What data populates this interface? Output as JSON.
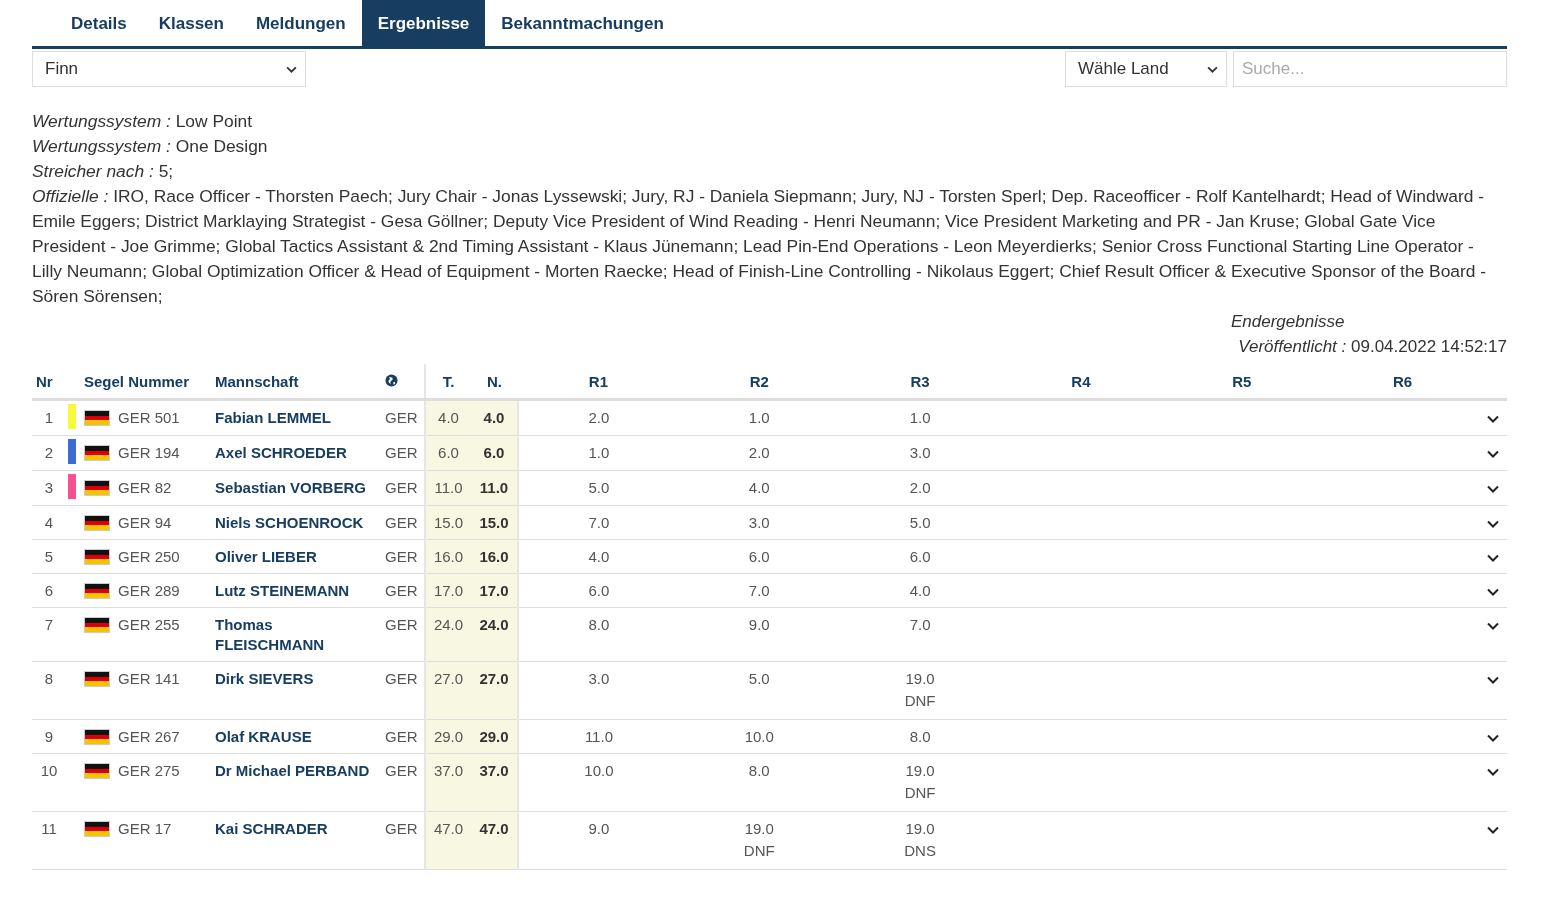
{
  "tabs": [
    {
      "label": "Details",
      "selected": false
    },
    {
      "label": "Klassen",
      "selected": false
    },
    {
      "label": "Meldungen",
      "selected": false
    },
    {
      "label": "Ergebnisse",
      "selected": true
    },
    {
      "label": "Bekanntmachungen",
      "selected": false
    }
  ],
  "class_select": {
    "value": "Finn"
  },
  "country_select": {
    "value": "Wähle Land"
  },
  "search": {
    "placeholder": "Suche..."
  },
  "info": [
    {
      "label": "Wertungssystem :",
      "value": "Low Point"
    },
    {
      "label": "Wertungssystem :",
      "value": "One Design"
    },
    {
      "label": "Streicher nach :",
      "value": "5;"
    },
    {
      "label": "Offizielle :",
      "value": "IRO, Race Officer - Thorsten Paech; Jury Chair - Jonas Lyssewski; Jury, RJ - Daniela Siepmann; Jury, NJ - Torsten Sperl; Dep. Raceofficer - Rolf Kantelhardt; Head of Windward - Emile Eggers; District Marklaying Strategist - Gesa Göllner; Deputy Vice President of Wind Reading - Henri Neumann; Vice President Marketing and PR - Jan Kruse; Global Gate Vice President - Joe Grimme; Global Tactics Assistant & 2nd Timing Assistant - Klaus Jünemann; Lead Pin-End Operations - Leon Meyerdierks; Senior Cross Functional Starting Line Operator - Lilly Neumann; Global Optimization Officer & Head of Equipment - Morten Raecke; Head of Finish-Line Controlling - Nikolaus Eggert; Chief Result Officer & Executive Sponsor of the Board - Sören Sörensen;"
    }
  ],
  "status": {
    "title": "Endergebnisse",
    "published_label": "Veröffentlicht :",
    "published_value": "09.04.2022 14:52:17"
  },
  "table": {
    "columns": {
      "nr": "Nr",
      "sail": "Segel Nummer",
      "crew": "Mannschaft",
      "total": "T.",
      "net": "N.",
      "races": [
        "R1",
        "R2",
        "R3",
        "R4",
        "R5",
        "R6"
      ]
    },
    "rows": [
      {
        "nr": "1",
        "color": "#f7f73c",
        "sail": "GER 501",
        "crew": "Fabian LEMMEL",
        "country": "GER",
        "total": "4.0",
        "net": "4.0",
        "races": [
          {
            "score": "2.0"
          },
          {
            "score": "1.0"
          },
          {
            "score": "1.0"
          }
        ]
      },
      {
        "nr": "2",
        "color": "#3a6ed6",
        "sail": "GER 194",
        "crew": "Axel SCHROEDER",
        "country": "GER",
        "total": "6.0",
        "net": "6.0",
        "races": [
          {
            "score": "1.0"
          },
          {
            "score": "2.0"
          },
          {
            "score": "3.0"
          }
        ]
      },
      {
        "nr": "3",
        "color": "#f5508f",
        "sail": "GER 82",
        "crew": "Sebastian VORBERG",
        "country": "GER",
        "total": "11.0",
        "net": "11.0",
        "races": [
          {
            "score": "5.0"
          },
          {
            "score": "4.0"
          },
          {
            "score": "2.0"
          }
        ]
      },
      {
        "nr": "4",
        "sail": "GER 94",
        "crew": "Niels SCHOENROCK",
        "country": "GER",
        "total": "15.0",
        "net": "15.0",
        "races": [
          {
            "score": "7.0"
          },
          {
            "score": "3.0"
          },
          {
            "score": "5.0"
          }
        ]
      },
      {
        "nr": "5",
        "sail": "GER 250",
        "crew": "Oliver LIEBER",
        "country": "GER",
        "total": "16.0",
        "net": "16.0",
        "races": [
          {
            "score": "4.0"
          },
          {
            "score": "6.0"
          },
          {
            "score": "6.0"
          }
        ]
      },
      {
        "nr": "6",
        "sail": "GER 289",
        "crew": "Lutz STEINEMANN",
        "country": "GER",
        "total": "17.0",
        "net": "17.0",
        "races": [
          {
            "score": "6.0"
          },
          {
            "score": "7.0"
          },
          {
            "score": "4.0"
          }
        ]
      },
      {
        "nr": "7",
        "sail": "GER 255",
        "crew": "Thomas FLEISCHMANN",
        "country": "GER",
        "total": "24.0",
        "net": "24.0",
        "races": [
          {
            "score": "8.0"
          },
          {
            "score": "9.0"
          },
          {
            "score": "7.0"
          }
        ]
      },
      {
        "nr": "8",
        "sail": "GER 141",
        "crew": "Dirk SIEVERS",
        "country": "GER",
        "total": "27.0",
        "net": "27.0",
        "races": [
          {
            "score": "3.0"
          },
          {
            "score": "5.0"
          },
          {
            "score": "19.0",
            "code": "DNF"
          }
        ]
      },
      {
        "nr": "9",
        "sail": "GER 267",
        "crew": "Olaf KRAUSE",
        "country": "GER",
        "total": "29.0",
        "net": "29.0",
        "races": [
          {
            "score": "11.0"
          },
          {
            "score": "10.0"
          },
          {
            "score": "8.0"
          }
        ]
      },
      {
        "nr": "10",
        "sail": "GER 275",
        "crew": "Dr Michael PERBAND",
        "country": "GER",
        "total": "37.0",
        "net": "37.0",
        "races": [
          {
            "score": "10.0"
          },
          {
            "score": "8.0"
          },
          {
            "score": "19.0",
            "code": "DNF"
          }
        ]
      },
      {
        "nr": "11",
        "sail": "GER 17",
        "crew": "Kai SCHRADER",
        "country": "GER",
        "total": "47.0",
        "net": "47.0",
        "races": [
          {
            "score": "9.0"
          },
          {
            "score": "19.0",
            "code": "DNF"
          },
          {
            "score": "19.0",
            "code": "DNS"
          }
        ]
      }
    ]
  }
}
